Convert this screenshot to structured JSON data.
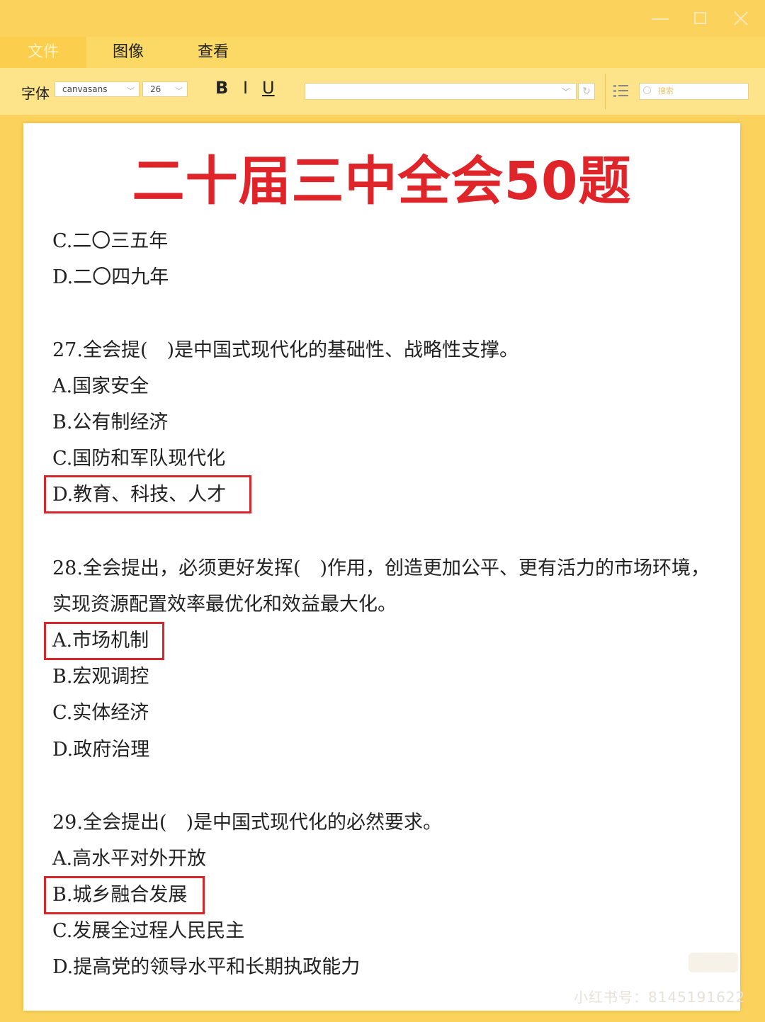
{
  "menubar": {
    "items": [
      "文件",
      "图像",
      "查看"
    ]
  },
  "toolbar": {
    "font_label": "字体",
    "font_value": "canvasans",
    "size_value": "26",
    "bold": "B",
    "italic": "I",
    "underline": "U",
    "search_placeholder": "搜索"
  },
  "document": {
    "title": "二十届三中全会50题",
    "lines": [
      "C.二〇三五年",
      "D.二〇四九年",
      "27.全会提(　)是中国式现代化的基础性、战略性支撑。",
      "A.国家安全",
      "B.公有制经济",
      "C.国防和军队现代化",
      "D.教育、科技、人才",
      "28.全会提出，必须更好发挥(　)作用，创造更加公平、更有活力的市场环境，",
      "实现资源配置效率最优化和效益最大化。",
      "A.市场机制",
      "B.宏观调控",
      "C.实体经济",
      "D.政府治理",
      "29.全会提出(　)是中国式现代化的必然要求。",
      "A.高水平对外开放",
      "B.城乡融合发展",
      "C.发展全过程人民民主",
      "D.提高党的领导水平和长期执政能力"
    ]
  },
  "watermark": "小红书号：8145191622",
  "colors": {
    "background": "#fbd35c",
    "title_red": "#e0252a",
    "highlight_box": "#d6262c"
  }
}
